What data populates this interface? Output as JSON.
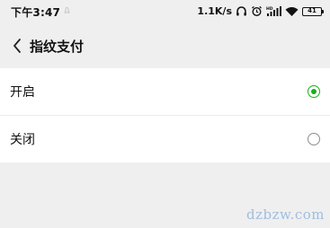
{
  "status_bar": {
    "time": "下午3:47",
    "net_speed": "1.1K/s",
    "battery_level": "41",
    "icons": [
      "notification-icon",
      "headphones-icon",
      "alarm-icon",
      "hd-signal-icon",
      "wifi-icon",
      "battery-icon"
    ]
  },
  "header": {
    "back_icon": "chevron-left-icon",
    "title": "指纹支付"
  },
  "options": [
    {
      "label": "开启",
      "selected": true
    },
    {
      "label": "关闭",
      "selected": false
    }
  ],
  "colors": {
    "accent": "#1aad19",
    "background": "#efefef",
    "card": "#ffffff"
  },
  "watermark": "dzbzw.com"
}
